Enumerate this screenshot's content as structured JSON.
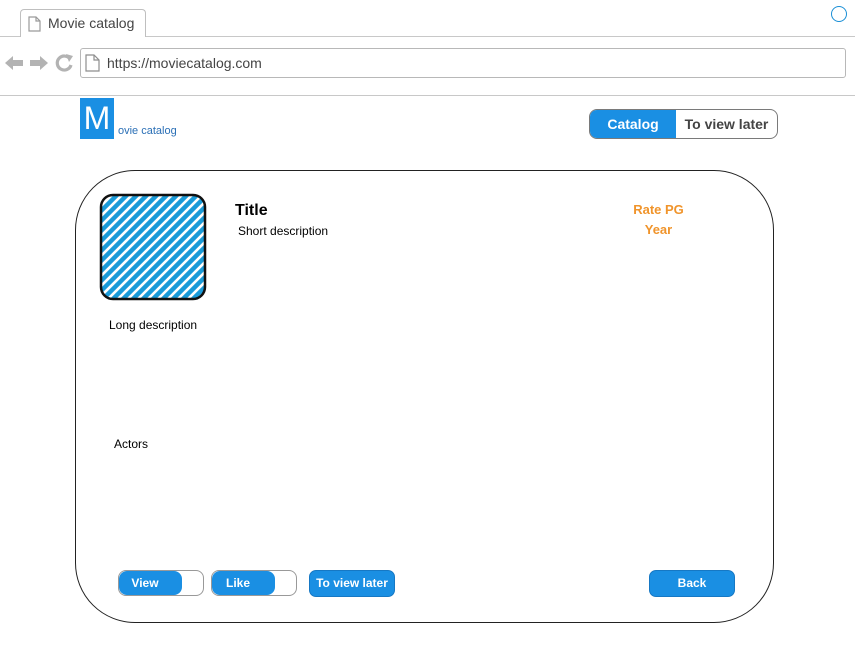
{
  "browser": {
    "tab_title": "Movie catalog",
    "url": "https://moviecatalog.com"
  },
  "header": {
    "logo_letter": "M",
    "logo_text": "ovie catalog",
    "nav": {
      "catalog_label": "Catalog",
      "view_later_label": "To view later"
    }
  },
  "movie": {
    "title": "Title",
    "short_description": "Short description",
    "rating": "Rate PG",
    "year": "Year",
    "long_description": "Long description",
    "actors": "Actors"
  },
  "actions": {
    "view_label": "View",
    "like_label": "Like",
    "view_later_label": "To view later",
    "back_label": "Back"
  },
  "colors": {
    "accent": "#1a8fe3",
    "highlight": "#f0942b",
    "logo_text": "#2a6fb6"
  }
}
